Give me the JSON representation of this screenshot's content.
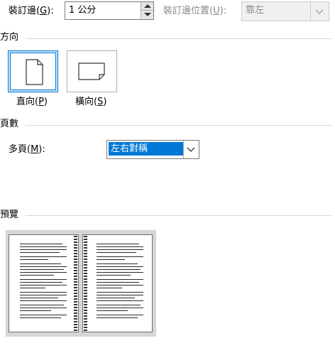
{
  "gutter": {
    "label_text": "裝訂邊(",
    "label_key": "G",
    "label_tail": "):",
    "value": "1 公分",
    "position_label_text": "裝訂邊位置(",
    "position_label_key": "U",
    "position_label_tail": "):",
    "position_value": "靠左"
  },
  "orientation": {
    "title": "方向",
    "portrait_text": "直向(",
    "portrait_key": "P",
    "portrait_tail": ")",
    "landscape_text": "橫向(",
    "landscape_key": "S",
    "landscape_tail": ")",
    "selected": "portrait"
  },
  "pages": {
    "title": "頁數",
    "multiple_label_text": "多頁(",
    "multiple_label_key": "M",
    "multiple_label_tail": "):",
    "multiple_value": "左右對稱"
  },
  "preview": {
    "title": "預覽"
  },
  "colors": {
    "accent": "#0078d7",
    "selected_bg": "#cce4f7",
    "separator": "#d9d9d9",
    "preview_bg": "#d6d6d6"
  },
  "icons": [
    "spin-up-icon",
    "spin-down-icon",
    "dropdown-arrow-icon",
    "portrait-page-icon",
    "landscape-page-icon"
  ]
}
